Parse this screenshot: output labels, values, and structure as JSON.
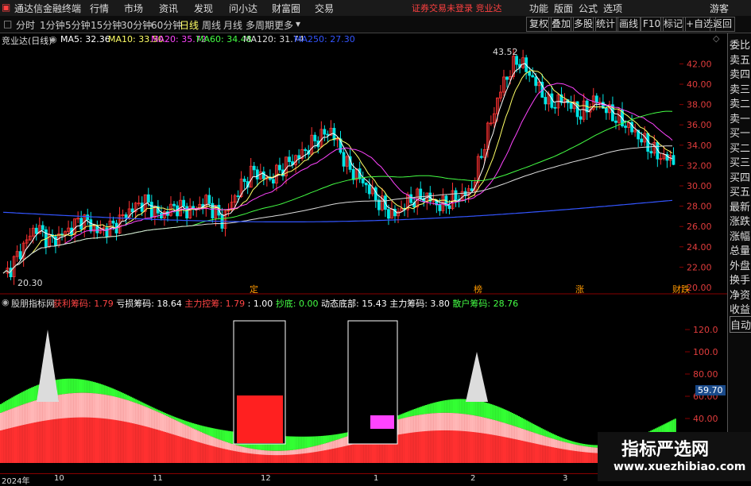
{
  "titlebar": {
    "app_name": "通达信金融终端",
    "menus": [
      "行情",
      "市场",
      "资讯",
      "发现",
      "问小达",
      "财富圈",
      "交易"
    ],
    "notice": "证券交易未登录  竞业达",
    "right_menus": [
      "功能",
      "版面",
      "公式",
      "选项"
    ],
    "guest": "游客"
  },
  "toolbar": {
    "periods": [
      "分时",
      "1分钟",
      "5分钟",
      "15分钟",
      "30分钟",
      "60分钟",
      "日线",
      "周线",
      "月线",
      "多周期",
      "更多"
    ],
    "selected": "日线",
    "right_buttons": [
      "复权",
      "叠加",
      "多股",
      "统计",
      "画线",
      "F10",
      "标记",
      "+自选",
      "返回"
    ]
  },
  "main_chart": {
    "title": "竞业达(日线)",
    "ma": [
      {
        "label": "MA5: 32.36",
        "color": "#ffffff"
      },
      {
        "label": "MA10: 33.50",
        "color": "#ffff66"
      },
      {
        "label": "MA20: 35.72",
        "color": "#ff44ff"
      },
      {
        "label": "MA60: 34.48",
        "color": "#44ff44"
      },
      {
        "label": "MA120: 31.74",
        "color": "#dddddd"
      },
      {
        "label": "MA250: 27.30",
        "color": "#3355ff"
      }
    ],
    "high_label": "43.52",
    "low_label": "20.30",
    "yticks": [
      "42.00",
      "40.00",
      "38.00",
      "36.00",
      "34.00",
      "32.00",
      "30.00",
      "28.00",
      "26.00",
      "24.00",
      "22.00",
      "20.00"
    ],
    "markers": [
      "定",
      "榜",
      "涨",
      "财跌"
    ]
  },
  "indicator": {
    "name": "股朋指标网",
    "fields": [
      {
        "label": "获利筹码:",
        "value": "1.79",
        "color": "#ff4444"
      },
      {
        "label": "亏损筹码:",
        "value": "18.64",
        "color": "#ffffff"
      },
      {
        "label": "主力控筹:",
        "value": "1.79",
        "color": "#ff4444"
      },
      {
        "label": ":",
        "value": "1.00",
        "color": "#ffffff"
      },
      {
        "label": "抄底:",
        "value": "0.00",
        "color": "#44ff44"
      },
      {
        "label": "动态底部:",
        "value": "15.43",
        "color": "#ffffff"
      },
      {
        "label": "主力筹码:",
        "value": "3.80",
        "color": "#ffffff"
      },
      {
        "label": "散户筹码:",
        "value": "28.76",
        "color": "#44ff44"
      }
    ],
    "yticks": [
      "120.0",
      "100.0",
      "80.00",
      "60.00",
      "40.00"
    ],
    "current_value": "59.70"
  },
  "right_panel": [
    "委比",
    "卖五",
    "卖四",
    "卖三",
    "卖二",
    "卖一",
    "买一",
    "买二",
    "买三",
    "买四",
    "买五",
    "最新",
    "涨跌",
    "涨幅",
    "总量",
    "外盘",
    "换手",
    "净资",
    "收益",
    "自动"
  ],
  "time_axis": [
    "2024年",
    "10",
    "11",
    "12",
    "1",
    "2",
    "3"
  ],
  "watermark": {
    "line1": "指标严选网",
    "line2": "www.xuezhibiao.com"
  },
  "chart_data": {
    "type": "candlestick",
    "title": "竞业达(日线)",
    "series": [
      {
        "name": "MA5",
        "last": 32.36
      },
      {
        "name": "MA10",
        "last": 33.5
      },
      {
        "name": "MA20",
        "last": 35.72
      },
      {
        "name": "MA60",
        "last": 34.48
      },
      {
        "name": "MA120",
        "last": 31.74
      },
      {
        "name": "MA250",
        "last": 27.3
      }
    ],
    "ylim": [
      20,
      43.52
    ],
    "y_ticks": [
      42,
      40,
      38,
      36,
      34,
      32,
      30,
      28,
      26,
      24,
      22,
      20
    ],
    "x_ticks": [
      "2024年",
      "10",
      "11",
      "12",
      "1",
      "2",
      "3"
    ],
    "high": 43.52,
    "low": 20.3,
    "close_path": [
      21.0,
      23.5,
      26.0,
      24.5,
      25.5,
      26.8,
      25.5,
      26.0,
      27.5,
      28.5,
      27.0,
      28.0,
      27.5,
      28.5,
      26.5,
      29.5,
      31.5,
      30.5,
      32.0,
      33.0,
      34.5,
      35.5,
      32.0,
      30.5,
      28.5,
      27.0,
      28.5,
      29.0,
      28.0,
      28.8,
      29.5,
      35.0,
      40.0,
      42.5,
      40.5,
      38.0,
      38.5,
      37.0,
      38.5,
      37.0,
      36.0,
      34.5,
      33.0,
      32.5
    ]
  }
}
